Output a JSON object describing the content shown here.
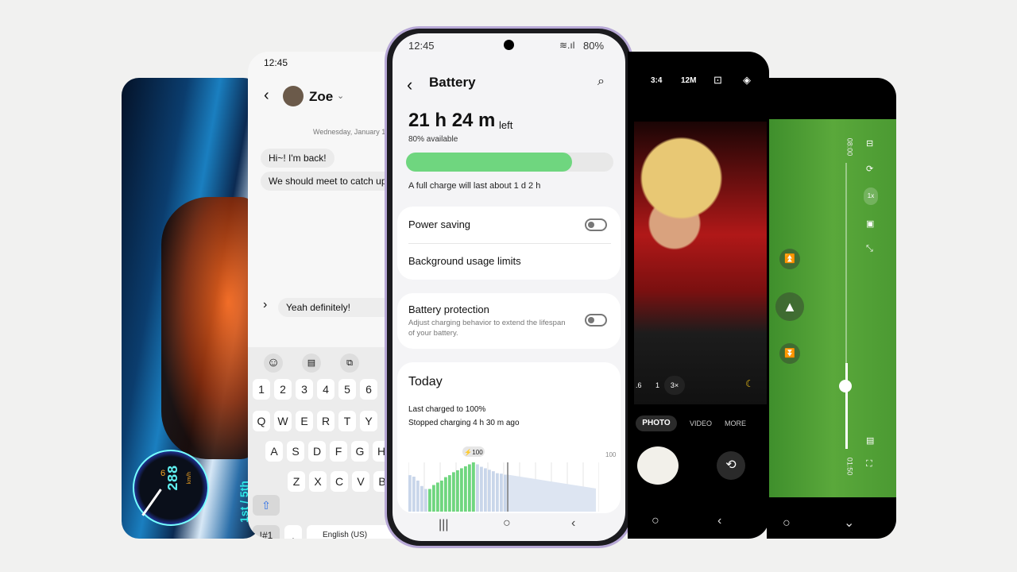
{
  "game": {
    "speed": "288",
    "gear": "6",
    "unit": "km/h",
    "position": "1st / 5th"
  },
  "messages": {
    "time": "12:45",
    "contact": "Zoe",
    "date": "Wednesday, January 1",
    "bubbles": [
      "Hi~! I'm back!",
      "We should meet to catch up"
    ],
    "input_value": "Yeah definitely!",
    "keys": {
      "numbers": [
        "1",
        "2",
        "3",
        "4",
        "5",
        "6"
      ],
      "row1": [
        "Q",
        "W",
        "E",
        "R",
        "T",
        "Y"
      ],
      "row2": [
        "A",
        "S",
        "D",
        "F",
        "G",
        "H"
      ],
      "row3": [
        "Z",
        "X",
        "C",
        "V",
        "B"
      ],
      "symbols": "!#1",
      "comma": ",",
      "language": "English (US)"
    }
  },
  "battery": {
    "time": "12:45",
    "signal": "80%",
    "title": "Battery",
    "remaining": "21 h 24 m",
    "left_label": "left",
    "available": "80% available",
    "level_percent": 80,
    "full_charge": "A full charge will last about 1 d 2 h",
    "power_saving": "Power saving",
    "power_saving_on": false,
    "background_limits": "Background usage limits",
    "protection": "Battery protection",
    "protection_desc": "Adjust charging behavior to extend the lifespan of your battery.",
    "protection_on": false,
    "today": "Today",
    "last_charged": "Last charged to 100%",
    "stopped": "Stopped charging 4 h 30 m ago",
    "chart_max_label": "100",
    "peak_label": "⚡100",
    "accent": "#6fd67f",
    "chart": {
      "values": [
        74,
        71,
        63,
        52,
        46,
        46,
        54,
        59,
        63,
        70,
        74,
        80,
        84,
        88,
        92,
        96,
        100,
        96,
        91,
        88,
        85,
        82,
        78,
        77,
        75
      ],
      "charging": [
        false,
        false,
        false,
        false,
        false,
        true,
        true,
        true,
        true,
        true,
        true,
        true,
        true,
        true,
        true,
        true,
        true,
        false,
        false,
        false,
        false,
        false,
        false,
        false,
        false
      ],
      "projected_end": 47
    }
  },
  "camera": {
    "ratio": "3:4",
    "resolution": "12M",
    "zoom_levels": [
      ".6",
      "1",
      "3×"
    ],
    "modes": [
      "PHOTO",
      "VIDEO",
      "MORE"
    ],
    "active_mode": "PHOTO"
  },
  "video": {
    "start_time": "01:50",
    "end_time": "08:00",
    "speed": "1x",
    "progress_percent": 30
  }
}
